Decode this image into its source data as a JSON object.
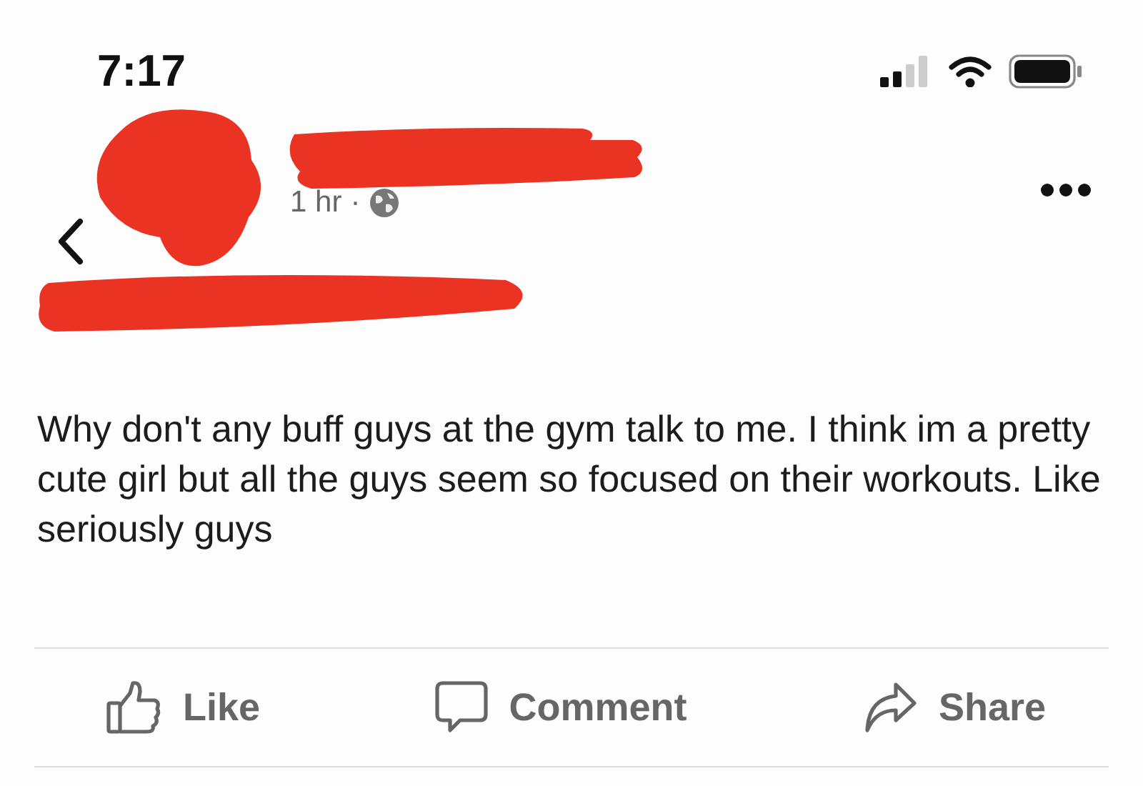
{
  "status_bar": {
    "time": "7:17"
  },
  "post": {
    "time": "1 hr",
    "separator": "·",
    "text": "Why don't any buff guys at the gym talk to me. I think im a pretty cute girl but all the guys seem so focused on their workouts. Like seriously guys"
  },
  "actions": [
    {
      "kind": "like",
      "label": "Like"
    },
    {
      "kind": "comment",
      "label": "Comment"
    },
    {
      "kind": "share",
      "label": "Share"
    }
  ]
}
